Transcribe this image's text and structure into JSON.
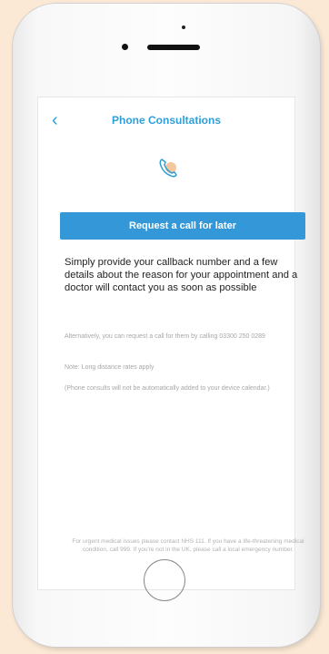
{
  "header": {
    "title": "Phone Consultations",
    "back_glyph": "‹"
  },
  "icons": {
    "back": "chevron-left-icon",
    "phone": "phone-handset-icon"
  },
  "actions": {
    "request_label": "Request a call for later"
  },
  "content": {
    "intro": "Simply provide your callback number and a few details about the reason for your appointment and a doctor will contact you as soon as possible",
    "alt_call": "Alternatively, you can request a call for them by calling 03300 250 0289",
    "note_rates": "Note: Long distance rates apply",
    "note_calendar": "(Phone consults will not be automatically added to your device calendar.)",
    "footer": "For urgent medical issues please contact NHS 111. If you have a life-threatening medical condition, call 999. If you're not in the UK, please call a local emergency number."
  },
  "colors": {
    "accent": "#2d9fd9",
    "button": "#3498d8",
    "background": "#fbe9d5"
  }
}
